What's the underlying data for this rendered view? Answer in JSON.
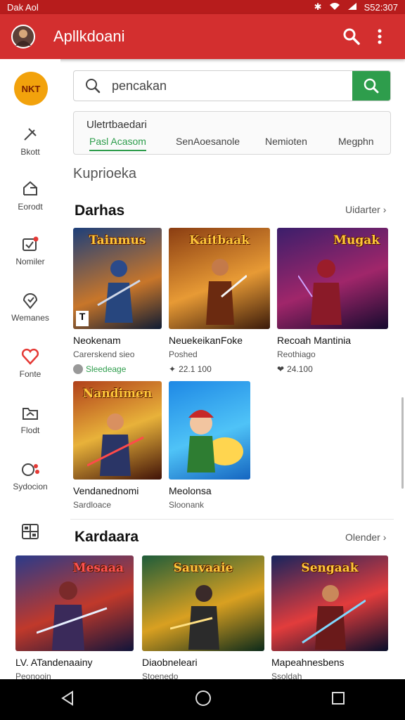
{
  "status_bar": {
    "left_text": "Dak Aol",
    "time": "S52:307"
  },
  "app_bar": {
    "title": "Apllkdoani"
  },
  "sidebar": {
    "logo_text": "NKT",
    "items": [
      {
        "label": "Bkott",
        "icon": "pin-icon"
      },
      {
        "label": "Eorodt",
        "icon": "share-icon"
      },
      {
        "label": "Nomiler",
        "icon": "inbox-icon"
      },
      {
        "label": "Wemanes",
        "icon": "location-icon"
      },
      {
        "label": "Fonte",
        "icon": "heart-icon"
      },
      {
        "label": "Flodt",
        "icon": "folder-icon"
      },
      {
        "label": "Sydocion",
        "icon": "apps-icon"
      },
      {
        "label": "",
        "icon": "grid-icon"
      }
    ]
  },
  "search": {
    "value": "pencakan"
  },
  "filter": {
    "title": "Uletrtbaedari",
    "tabs": [
      "Pasl Acasom",
      "SenAoesanole",
      "Nemioten",
      "Megphn"
    ]
  },
  "section_label": "Kuprioeka",
  "sections": [
    {
      "title": "Darhas",
      "more": "Uidarter",
      "games": [
        {
          "name": "Neokenam",
          "sub": "Carerskend sieo",
          "meta": "Sleedeage",
          "meta_green": true,
          "thumb_title": "Tainmus",
          "colors": [
            "#1d3f7a",
            "#c8762a",
            "#0e1b33"
          ]
        },
        {
          "name": "NeuekeikanFoke",
          "sub": "Poshed",
          "meta": "22.1 100",
          "meta_green": false,
          "thumb_title": "Kaitbaak",
          "colors": [
            "#8a3d12",
            "#e79a35",
            "#3a1a0a"
          ]
        },
        {
          "name": "Recoah Mantinia",
          "sub": "Reothiago",
          "meta": "24.100",
          "meta_green": false,
          "thumb_title": "Mugak",
          "colors": [
            "#3b1e6b",
            "#a0266a",
            "#150a2e"
          ]
        },
        {
          "name": "Vendanednomi",
          "sub": "Sardloace",
          "meta": "",
          "meta_green": false,
          "thumb_title": "Nandimen",
          "colors": [
            "#b0401a",
            "#e8b23a",
            "#401208"
          ]
        },
        {
          "name": "Meolonsa",
          "sub": "Sloonank",
          "meta": "",
          "meta_green": false,
          "thumb_title": "",
          "colors": [
            "#1e88e5",
            "#4fc3f7",
            "#1565c0"
          ]
        }
      ]
    },
    {
      "title": "Kardaara",
      "more": "Olender",
      "games": [
        {
          "name": "LV. ATandenaainy",
          "sub": "Peonooin",
          "thumb_title": "Mesaaa",
          "colors": [
            "#2a3a8a",
            "#c0392b",
            "#10143a"
          ]
        },
        {
          "name": "Diaobneleari",
          "sub": "Stoenedo",
          "thumb_title": "Sauvaaie",
          "colors": [
            "#1e5c3a",
            "#d9a021",
            "#0b2a1a"
          ]
        },
        {
          "name": "Mapeahnesbens",
          "sub": "Ssoldah",
          "thumb_title": "Sengaak",
          "colors": [
            "#16245e",
            "#e23c3c",
            "#080e2a"
          ]
        }
      ]
    }
  ],
  "colors": {
    "app_bar": "#d32f2f",
    "accent_green": "#2e9d4c"
  }
}
